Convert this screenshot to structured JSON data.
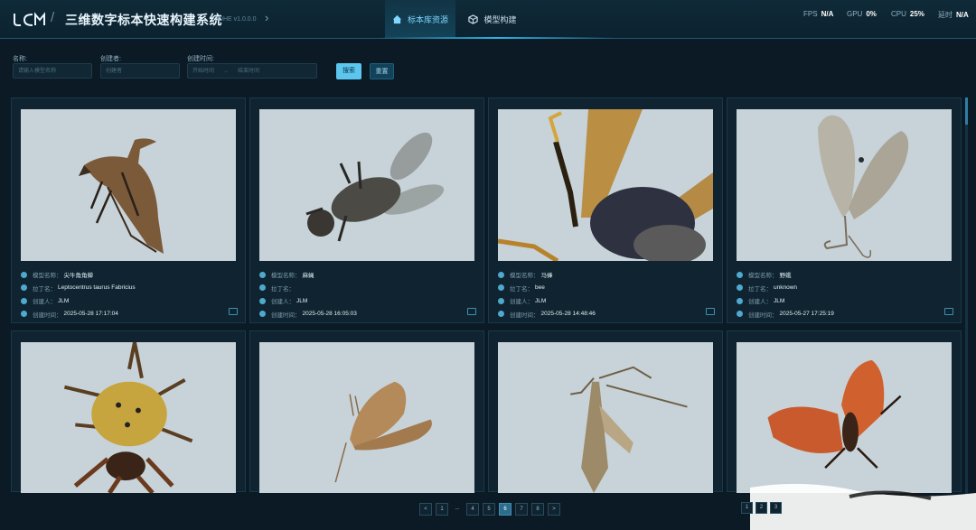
{
  "app": {
    "title": "三维数字标本快速构建系统",
    "version": "3DHE v1.0.0.0"
  },
  "nav": {
    "tabs": [
      {
        "label": "标本库资源",
        "active": true
      },
      {
        "label": "模型构建",
        "active": false
      }
    ]
  },
  "stats": [
    {
      "label": "FPS",
      "value": "N/A"
    },
    {
      "label": "GPU",
      "value": "0%"
    },
    {
      "label": "CPU",
      "value": "25%"
    },
    {
      "label": "延时",
      "value": "N/A"
    }
  ],
  "filters": {
    "name_label": "名称:",
    "name_placeholder": "请输入模型名称",
    "creator_label": "创建者:",
    "creator_placeholder": "创建者",
    "time_label": "创建时间:",
    "start_placeholder": "开始时间",
    "sep": "→",
    "end_placeholder": "结束时间",
    "search_button": "搜索",
    "reset_button": "重置"
  },
  "field_labels": {
    "model_name": "模型名称：",
    "latin_name": "拉丁名：",
    "creator": "创建人：",
    "created_time": "创建时间："
  },
  "cards": [
    {
      "name": "尖牛角角蝉",
      "latin": "Leptocentrus taurus Fabricius",
      "creator": "JLM",
      "time": "2025-05-28 17:17:04",
      "art": "treehopper"
    },
    {
      "name": "麻蝇",
      "latin": "",
      "creator": "JLM",
      "time": "2025-05-28 16:05:03",
      "art": "fly"
    },
    {
      "name": "马蜂",
      "latin": "bee",
      "creator": "JLM",
      "time": "2025-05-28 14:48:46",
      "art": "wasp"
    },
    {
      "name": "野蛾",
      "latin": "unknown",
      "creator": "JLM",
      "time": "2025-05-27 17:25:19",
      "art": "whitemoth"
    },
    {
      "name": "",
      "latin": "",
      "creator": "",
      "time": "",
      "art": "spider"
    },
    {
      "name": "",
      "latin": "",
      "creator": "",
      "time": "",
      "art": "moth1"
    },
    {
      "name": "",
      "latin": "",
      "creator": "",
      "time": "",
      "art": "moth2"
    },
    {
      "name": "",
      "latin": "",
      "creator": "",
      "time": "",
      "art": "redmoth"
    }
  ],
  "pagination": {
    "prev": "<",
    "pages": [
      "1",
      "...",
      "4",
      "5",
      "6",
      "7",
      "8"
    ],
    "current": "6",
    "next": ">"
  },
  "pagination_overlay": [
    "1",
    "2",
    "3"
  ],
  "colors": {
    "background": "#0b1a24",
    "accent": "#2fb4e6",
    "card": "#0f2430",
    "thumb_bg": "#c7d3d8"
  }
}
